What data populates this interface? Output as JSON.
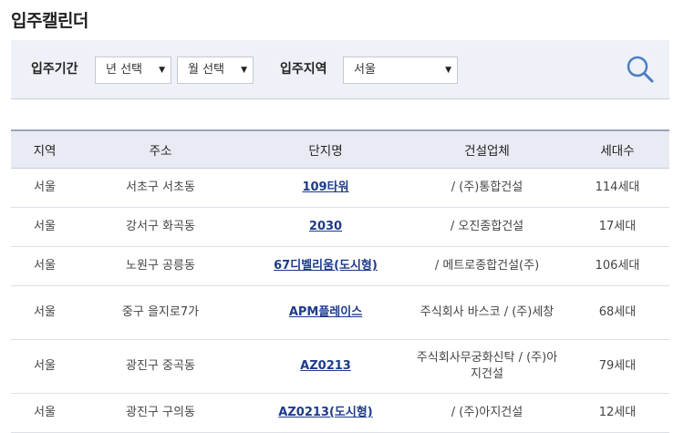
{
  "page": {
    "title": "입주캘린더"
  },
  "filters": {
    "period_label": "입주기간",
    "year_select": "년 선택",
    "month_select": "월 선택",
    "region_label": "입주지역",
    "region_select": "서울",
    "search_icon": "search-icon"
  },
  "table": {
    "headers": [
      "지역",
      "주소",
      "단지명",
      "건설업체",
      "세대수"
    ],
    "rows": [
      {
        "region": "서울",
        "address": "서초구 서초동",
        "name": "109타워",
        "builder": "/ (주)통합건설",
        "units": "114세대"
      },
      {
        "region": "서울",
        "address": "강서구 화곡동",
        "name": "2030",
        "builder": "/ 오진종합건설",
        "units": "17세대"
      },
      {
        "region": "서울",
        "address": "노원구 공릉동",
        "name": "67디벨리움(도시형)",
        "builder": "/ 메트로종합건설(주)",
        "units": "106세대"
      },
      {
        "region": "서울",
        "address": "중구 을지로7가",
        "name": "APM플레이스",
        "builder": "주식회사 바스코 / (주)세창",
        "units": "68세대"
      },
      {
        "region": "서울",
        "address": "광진구 중곡동",
        "name": "AZ0213",
        "builder": "주식회사무궁화신탁 / (주)아지건설",
        "units": "79세대"
      },
      {
        "region": "서울",
        "address": "광진구 구의동",
        "name": "AZ0213(도시형)",
        "builder": "/ (주)아지건설",
        "units": "12세대"
      }
    ]
  }
}
